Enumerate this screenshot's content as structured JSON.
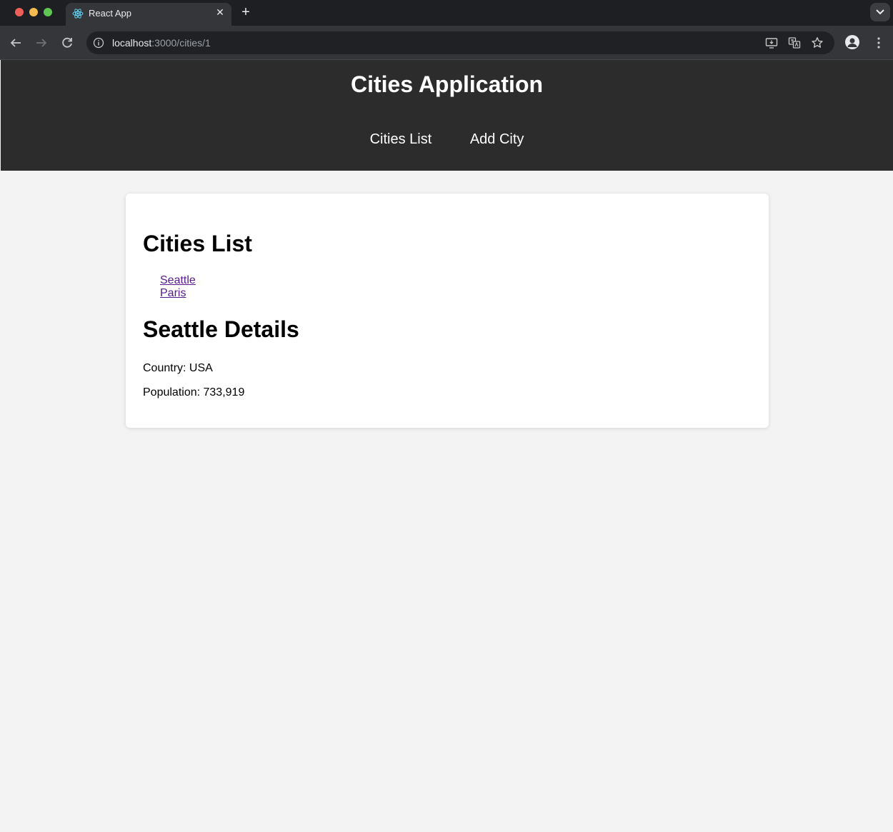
{
  "browser": {
    "tab_title": "React App",
    "url_host": "localhost",
    "url_path": ":3000/cities/1"
  },
  "app": {
    "title": "Cities Application",
    "nav": [
      "Cities List",
      "Add City"
    ]
  },
  "content": {
    "list_heading": "Cities List",
    "cities": [
      "Seattle",
      "Paris"
    ],
    "details_heading": "Seattle Details",
    "country_line": "Country: USA",
    "population_line": "Population: 733,919"
  },
  "colors": {
    "header_bg": "#2c2c2c",
    "page_bg": "#f3f3f3",
    "link_visited": "#551a8b"
  }
}
